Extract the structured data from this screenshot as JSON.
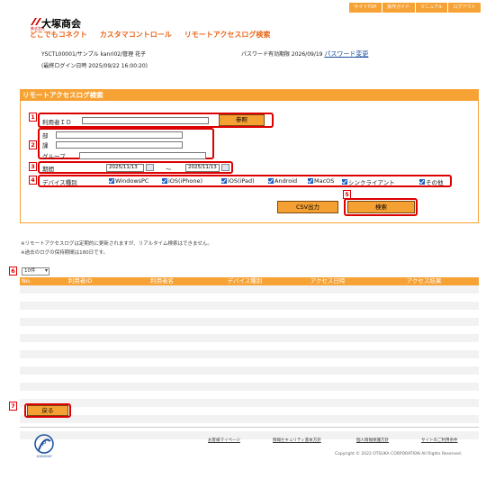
{
  "topnav": [
    "サイトTOP",
    "操作ガイド",
    "マニュアル",
    "ログアウト"
  ],
  "brand": {
    "logo_text": "大塚商会",
    "logo_sub": "株式会社",
    "app_name": "どこでもコネクト",
    "section": "カスタマコントロール",
    "page": "リモートアクセスログ検索"
  },
  "user": {
    "info": "YSCTL00001/サンプル kanri02/管理 花子",
    "last_login": "(最終ログイン日時 2025/09/22 16:00:20)",
    "pw_expiry": "パスワード有効期限 2026/09/19",
    "pw_change": "パスワード変更"
  },
  "panel": {
    "title": "リモートアクセスログ検索"
  },
  "form": {
    "user_id_label": "利用者ＩＤ",
    "browse_button": "参照",
    "dept_label": "部",
    "section_label": "課",
    "group_label": "グループ",
    "period_label": "期間",
    "date_from": "2025/11/13",
    "date_to": "2025/11/13",
    "tilde": "～",
    "device_label": "デバイス種別",
    "devices": [
      "WindowsPC",
      "iOS(iPhone)",
      "iOS(iPad)",
      "Android",
      "MacOS",
      "シンクライアント",
      "その他"
    ],
    "csv_button": "CSV出力",
    "search_button": "検索"
  },
  "markers": [
    "1",
    "2",
    "3",
    "4",
    "5",
    "6",
    "7"
  ],
  "notes": [
    "※リモートアクセスログは定期的に更新されますが、リアルタイム検索はできません。",
    "※過去のログの保持期間は180日です。"
  ],
  "page_size": "10件",
  "table": {
    "columns": [
      "No.",
      "利用者ID",
      "利用者名",
      "デバイス種別",
      "アクセス日時",
      "アクセス結果"
    ],
    "row_count": 10
  },
  "back_button": "戻る",
  "footer": {
    "links": [
      "お客様マイページ",
      "情報セキュリティ基本方針",
      "個人情報保護方針",
      "サイトのご利用条件"
    ],
    "copyright": "Copyright © 2022 OTSUKA CORPORATION All Rights Reserved.",
    "privacy_mark": "10820067"
  },
  "colors": {
    "accent": "#f7a234",
    "highlight": "#dd0000",
    "title": "#e8671b",
    "link": "#1a4fa0"
  }
}
